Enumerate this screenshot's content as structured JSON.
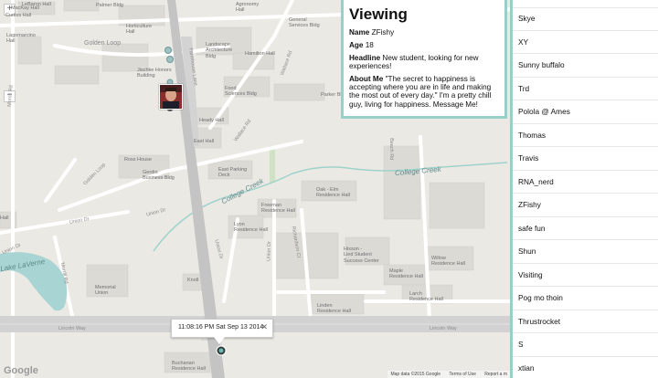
{
  "viewing": {
    "title": "Viewing",
    "name_label": "Name",
    "name": "ZFishy",
    "age_label": "Age",
    "age": "18",
    "headline_label": "Headline",
    "headline": "New student, looking for new experiences!",
    "about_label": "About Me",
    "about": "\"The secret to happiness is accepting where you are in life and making the most out of every day.\" I'm a pretty chill guy, living for happiness. Message Me!"
  },
  "infowindow": {
    "timestamp": "11:08:16 PM Sat Sep 13 2014",
    "close": "✕"
  },
  "users": [
    "Skye",
    "XY",
    "Sunny buffalo",
    "Trd",
    "Polola @ Ames",
    "Thomas",
    "Travis",
    "RNA_nerd",
    "ZFishy",
    "safe fun",
    "Shun",
    "Visiting",
    "Pog mo thoin",
    "Thrustrocket",
    "S",
    "xtian"
  ],
  "map": {
    "zoom_in": "+",
    "zoom_out": "−",
    "google": "Google",
    "attribution": {
      "data": "Map data ©2015 Google",
      "terms": "Terms of Use",
      "report": "Report a m"
    },
    "labels": {
      "lebaron": "LeBaron Hall",
      "palmer": "Palmer Bldg",
      "agronomy": "Agronomy\nHall",
      "general_services": "General\nServices Bldg",
      "horticulture": "Horticulture\nHall",
      "landscape": "Landscape\nArchitecture\nBldg",
      "hamilton": "Hamilton Hall",
      "mackay": "MacKay Hall",
      "curtiss": "Curtiss Hall",
      "lagomarcino": "Lagomarcino\nHall",
      "golden_loop": "Golden Loop",
      "joch": "Jischke Honors\nBuilding",
      "food": "Food\nSciences Bldg",
      "parker": "Parker Bldg",
      "heady": "Heady Hall",
      "east_hall": "East Hall",
      "ross": "Ross House",
      "gerdin": "Gerdin\nBusiness Bldg",
      "east_parking": "East Parking\nDeck",
      "oak_elm": "Oak - Elm\nResidence Hall",
      "freeman": "Freeman\nResidence Hall",
      "lyon": "Lyon\nResidence Hall",
      "hixson": "Hixson -\nLied Student\nSuccess Center",
      "willow": "Willow\nResidence Hall",
      "maple": "Maple\nResidence Hall",
      "larch": "Larch\nResidence Hall",
      "linden": "Linden\nResidence Hall",
      "memorial": "Memorial\nUnion",
      "knoll": "Knoll",
      "buchanan": "Buchanan\nResidence Hall",
      "hall": "Hall",
      "college_creek": "College Creek",
      "college_creek_2": "College Creek",
      "lake": "Lake LaVerne",
      "union_dr": "Union Dr",
      "union_dr_2": "Union Dr",
      "union_dr_3": "Union Dr",
      "lincoln_way": "Lincoln Way",
      "lincoln_way_2": "Lincoln Way",
      "farmhouse": "Farmhouse Lane",
      "wallace": "Wallace Rd",
      "wallace_2": "Wallace Rd",
      "beach": "Beach Rd",
      "richardson": "Richardson Ct",
      "gaskill": "Gaskill Dr",
      "morrill": "Morrill Rd",
      "morrill_2": "Morrill Rd",
      "osborn": "Osborn Dr",
      "union_dr_4": "Union Dr",
      "stange": "Stange Rd",
      "golden_loop_2": "Golden Loop",
      "morrill_3": "Morrill Rd",
      "welch": "Welch Rd"
    }
  }
}
